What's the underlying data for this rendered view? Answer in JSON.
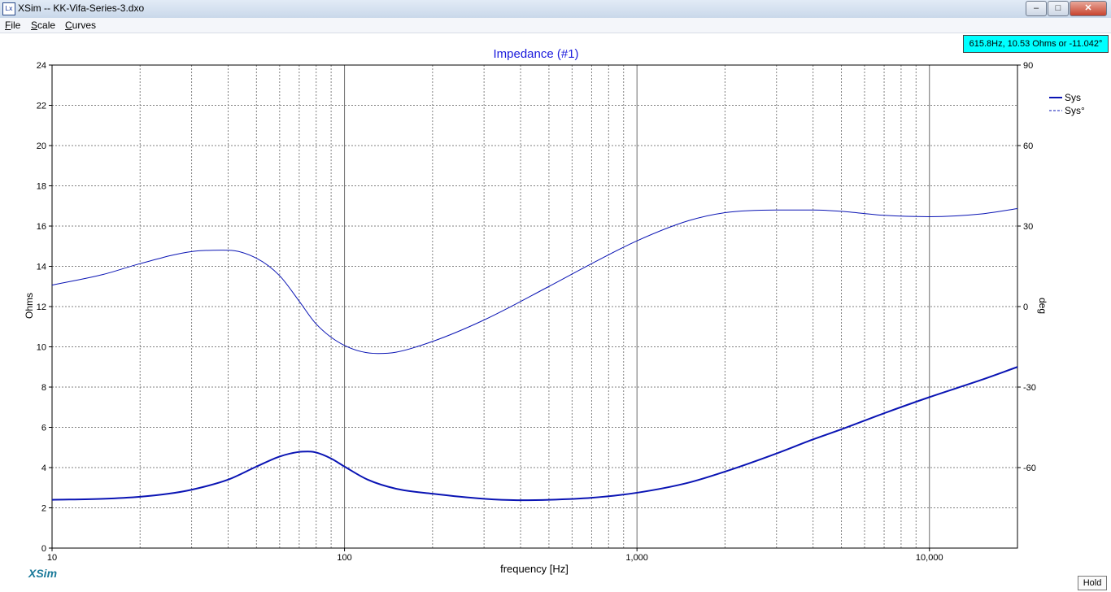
{
  "window": {
    "title": "XSim -- KK-Vifa-Series-3.dxo",
    "icon_label": "Lx",
    "controls": {
      "minimize": "–",
      "maximize": "□",
      "close": "✕"
    }
  },
  "menu": [
    {
      "label": "File",
      "accel": "F",
      "rest": "ile"
    },
    {
      "label": "Scale",
      "accel": "S",
      "rest": "cale"
    },
    {
      "label": "Curves",
      "accel": "C",
      "rest": "urves"
    }
  ],
  "readout": "615.8Hz, 10.53 Ohms or -11.042°",
  "brand": "XSim",
  "hold_button": "Hold",
  "chart_data": {
    "type": "line",
    "title": "Impedance (#1)",
    "xlabel": "frequency [Hz]",
    "ylabel": "Ohms",
    "y2label": "deg",
    "xscale": "log",
    "xlim": [
      10,
      20000
    ],
    "ylim": [
      0,
      24
    ],
    "y2lim": [
      -90,
      90
    ],
    "x_ticks": [
      {
        "value": 10,
        "label": "10"
      },
      {
        "value": 100,
        "label": "100"
      },
      {
        "value": 1000,
        "label": "1,000"
      },
      {
        "value": 10000,
        "label": "10,000"
      }
    ],
    "y_ticks": [
      0,
      2,
      4,
      6,
      8,
      10,
      12,
      14,
      16,
      18,
      20,
      22,
      24
    ],
    "y2_ticks": [
      -60,
      -30,
      0,
      30,
      60,
      90
    ],
    "grid": true,
    "legend_position": "top-right",
    "colors": {
      "curve": "#0a14b4",
      "title": "#1a1adc",
      "grid": "#808080"
    },
    "series": [
      {
        "name": "Sys",
        "axis": "left",
        "style": "solid",
        "x": [
          10,
          15,
          20,
          25,
          30,
          40,
          50,
          60,
          70,
          75,
          80,
          90,
          100,
          120,
          150,
          200,
          300,
          400,
          500,
          700,
          1000,
          1500,
          2000,
          3000,
          4000,
          5000,
          7000,
          10000,
          15000,
          20000
        ],
        "y": [
          2.4,
          2.45,
          2.55,
          2.7,
          2.9,
          3.4,
          4.05,
          4.55,
          4.78,
          4.8,
          4.75,
          4.45,
          4.05,
          3.4,
          2.95,
          2.7,
          2.45,
          2.38,
          2.4,
          2.5,
          2.75,
          3.25,
          3.8,
          4.7,
          5.4,
          5.9,
          6.7,
          7.5,
          8.35,
          9.0
        ]
      },
      {
        "name": "Sys°",
        "axis": "right",
        "style": "dashed",
        "x": [
          10,
          15,
          20,
          30,
          40,
          50,
          60,
          70,
          80,
          100,
          130,
          150,
          200,
          300,
          500,
          700,
          1000,
          1500,
          2000,
          3000,
          4000,
          5000,
          7000,
          10000,
          15000,
          20000
        ],
        "y": [
          8,
          12,
          16,
          20.5,
          21,
          18,
          11.5,
          2,
          -6.5,
          -14.5,
          -17.5,
          -17,
          -13,
          -5,
          7.5,
          16,
          24.5,
          32,
          35,
          36,
          36,
          35.5,
          34,
          33.5,
          34.5,
          36.5
        ]
      }
    ]
  }
}
